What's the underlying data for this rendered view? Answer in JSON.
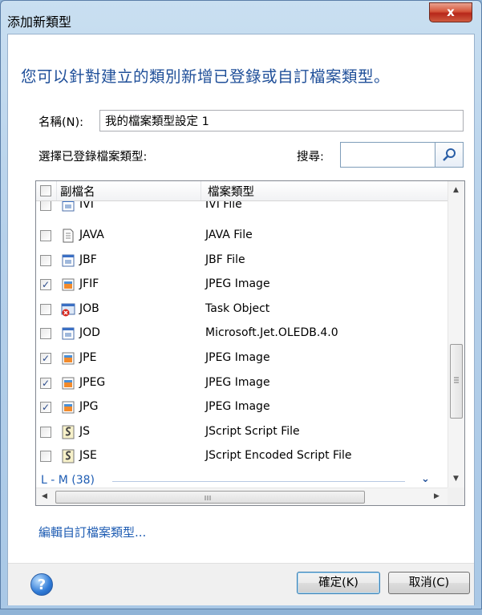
{
  "window": {
    "title": "添加新類型",
    "close_label": "x"
  },
  "headline": "您可以針對建立的類別新增已登錄或自訂檔案類型。",
  "name_field": {
    "label": "名稱(N):",
    "value": "我的檔案類型設定 1"
  },
  "registered_label": "選擇已登錄檔案類型:",
  "search": {
    "label": "搜尋:",
    "value": ""
  },
  "list": {
    "columns": [
      "副檔名",
      "檔案類型"
    ],
    "rows": [
      {
        "ext": "JAVA",
        "type": "JAVA File",
        "checked": false,
        "icon": "text-file-icon"
      },
      {
        "ext": "JBF",
        "type": "JBF File",
        "checked": false,
        "icon": "window-file-icon"
      },
      {
        "ext": "JFIF",
        "type": "JPEG Image",
        "checked": true,
        "icon": "image-file-icon"
      },
      {
        "ext": "JOB",
        "type": "Task Object",
        "checked": false,
        "icon": "task-object-icon"
      },
      {
        "ext": "JOD",
        "type": "Microsoft.Jet.OLEDB.4.0",
        "checked": false,
        "icon": "window-file-icon"
      },
      {
        "ext": "JPE",
        "type": "JPEG Image",
        "checked": true,
        "icon": "image-file-icon"
      },
      {
        "ext": "JPEG",
        "type": "JPEG Image",
        "checked": true,
        "icon": "image-file-icon"
      },
      {
        "ext": "JPG",
        "type": "JPEG Image",
        "checked": true,
        "icon": "image-file-icon"
      },
      {
        "ext": "JS",
        "type": "JScript Script File",
        "checked": false,
        "icon": "script-file-icon"
      },
      {
        "ext": "JSE",
        "type": "JScript Encoded Script File",
        "checked": false,
        "icon": "script-file-icon"
      }
    ],
    "partial_row": {
      "ext": "IVI",
      "type": "IVI File"
    },
    "group_label": "L - M (38)"
  },
  "edit_link": "編輯自訂檔案類型...",
  "buttons": {
    "ok": "確定(K)",
    "cancel": "取消(C)"
  },
  "help_label": "?"
}
